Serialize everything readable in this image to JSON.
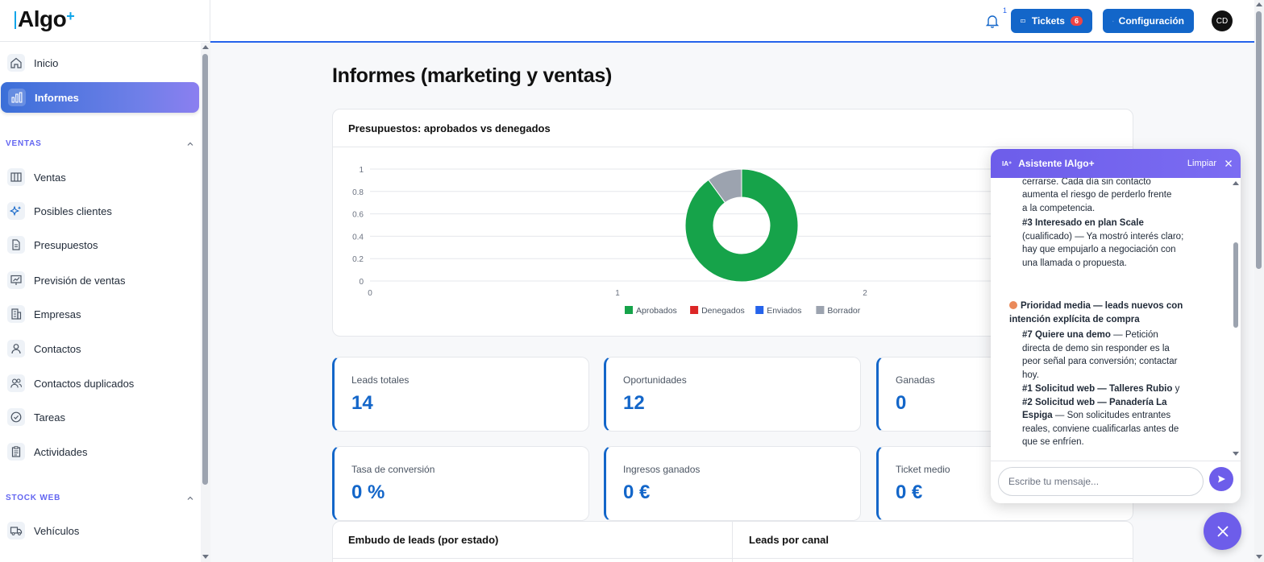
{
  "logo": {
    "name": "Algo",
    "plus": "+"
  },
  "sidebar": {
    "items": [
      {
        "label": "Inicio"
      },
      {
        "label": "Informes"
      },
      {
        "label": "Ventas"
      },
      {
        "label": "Posibles clientes"
      },
      {
        "label": "Presupuestos"
      },
      {
        "label": "Previsión de ventas"
      },
      {
        "label": "Empresas"
      },
      {
        "label": "Contactos"
      },
      {
        "label": "Contactos duplicados"
      },
      {
        "label": "Tareas"
      },
      {
        "label": "Actividades"
      },
      {
        "label": "Vehículos"
      }
    ],
    "sections": {
      "ventas": "VENTAS",
      "stock": "STOCK WEB"
    },
    "active_item": "Informes"
  },
  "topbar": {
    "notification_count": "1",
    "tickets_label": "Tickets",
    "tickets_count": "6",
    "config_label": "Configuración",
    "avatar_initials": "CD"
  },
  "page": {
    "title": "Informes (marketing y ventas)"
  },
  "budget_chart": {
    "title": "Presupuestos: aprobados vs denegados",
    "y_ticks": [
      "1",
      "0.8",
      "0.6",
      "0.4",
      "0.2",
      "0"
    ],
    "x_ticks": [
      "0",
      "1",
      "2"
    ]
  },
  "chart_data": {
    "type": "pie",
    "title": "Presupuestos: aprobados vs denegados",
    "categories": [
      "Aprobados",
      "Denegados",
      "Enviados",
      "Borrador"
    ],
    "values": [
      90,
      0,
      0,
      10
    ],
    "colors": [
      "#16a34a",
      "#dc2626",
      "#2563eb",
      "#9ca3af"
    ],
    "legend_position": "bottom"
  },
  "kpis": [
    {
      "label": "Leads totales",
      "value": "14"
    },
    {
      "label": "Oportunidades",
      "value": "12"
    },
    {
      "label": "Ganadas",
      "value": "0"
    },
    {
      "label": "Tasa de conversión",
      "value": "0 %"
    },
    {
      "label": "Ingresos ganados",
      "value": "0 €"
    },
    {
      "label": "Ticket medio",
      "value": "0 €"
    }
  ],
  "bottom_cards": {
    "funnel_title": "Embudo de leads (por estado)",
    "channel_title": "Leads por canal"
  },
  "chat": {
    "title": "Asistente IAlgo+",
    "header_icon_text": "IA⁺",
    "clear_label": "Limpiar",
    "l1": "cerrarse. Cada día sin contacto",
    "l2": "aumenta el riesgo de perderlo frente",
    "l3": "a la competencia.",
    "m3_title": "#3 Interesado en plan Scale",
    "m3_text": "(cualificado) — Ya mostró interés claro; hay que empujarlo a negociación con una llamada o propuesta.",
    "priority_title": "Prioridad media — leads nuevos con intención explícita de compra",
    "m7_title": "#7 Quiere una demo",
    "m7_text": " — Petición directa de demo sin responder es la peor señal para conversión; contactar hoy.",
    "m1_title": "#1 Solicitud web — Talleres Rubio",
    "m1_and": " y ",
    "m2_title": "#2 Solicitud web — Panadería La Espiga",
    "m2_text": " — Son solicitudes entrantes reales, conviene cualificarlas antes de que se enfríen.",
    "input_placeholder": "Escribe tu mensaje..."
  }
}
